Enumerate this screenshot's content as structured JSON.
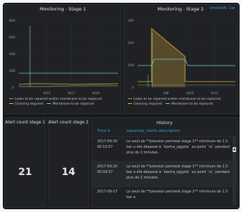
{
  "panels": {
    "stage1": {
      "title": "Monitoring - Stage 1",
      "y_ticks": [
        "800",
        "600",
        "400",
        "200",
        "0"
      ],
      "x_ticks": [
        "9/15",
        "9/17",
        "9/19"
      ],
      "legend": [
        {
          "label": "Leaks to be repaired and/or membrane to be replaced",
          "color": "#7eb26d"
        },
        {
          "label": "Cleaning required",
          "color": "#eab839"
        },
        {
          "label": "Membrane to be replaced",
          "color": "#6ed0e0"
        }
      ]
    },
    "stage2": {
      "title": "Monitoring - Stage 2",
      "link": "timeshift -1w",
      "y_ticks": [
        "300",
        "200",
        "100",
        "0"
      ],
      "x_ticks": [
        "9/8",
        "9/10",
        "9/12"
      ],
      "legend": [
        {
          "label": "Leaks to be repaired and/or membrane to be replaced",
          "color": "#7eb26d"
        },
        {
          "label": "Cleaning required",
          "color": "#eab839"
        },
        {
          "label": "Membrane to be replaced",
          "color": "#6ed0e0"
        }
      ]
    },
    "alert1": {
      "title": "Alert count stage 1",
      "value": "21"
    },
    "alert2": {
      "title": "Alert count stage 2",
      "value": "14"
    },
    "history": {
      "title": "History",
      "col_time": "Time ▾",
      "col_desc": "aquassay_alerts.description",
      "rows": [
        {
          "time": "2017-09-20 00:10:57",
          "desc": "Le seuil de **pression perméat stage 1** minimum de 1.5 bar a été dépassé à `banha_egypte` au point `ro` pendant plus de 2 minutes."
        },
        {
          "time": "2017-09-20 00:09:57",
          "desc": "Le seuil de **pression perméat stage 1** minimum de 1.5 bar a été dépassé à `banha_egypte` au point `ro` pendant plus de 2 minutes."
        },
        {
          "time": "2017-09-17",
          "desc": "Le seuil de **pression perméat stage 1** minimum de 1.5 bar a"
        }
      ]
    }
  },
  "colors": {
    "green": "#7eb26d",
    "yellow": "#eab839",
    "cyan": "#6ed0e0",
    "panel_bg": "#1f2125",
    "accent": "#33a2e5"
  }
}
